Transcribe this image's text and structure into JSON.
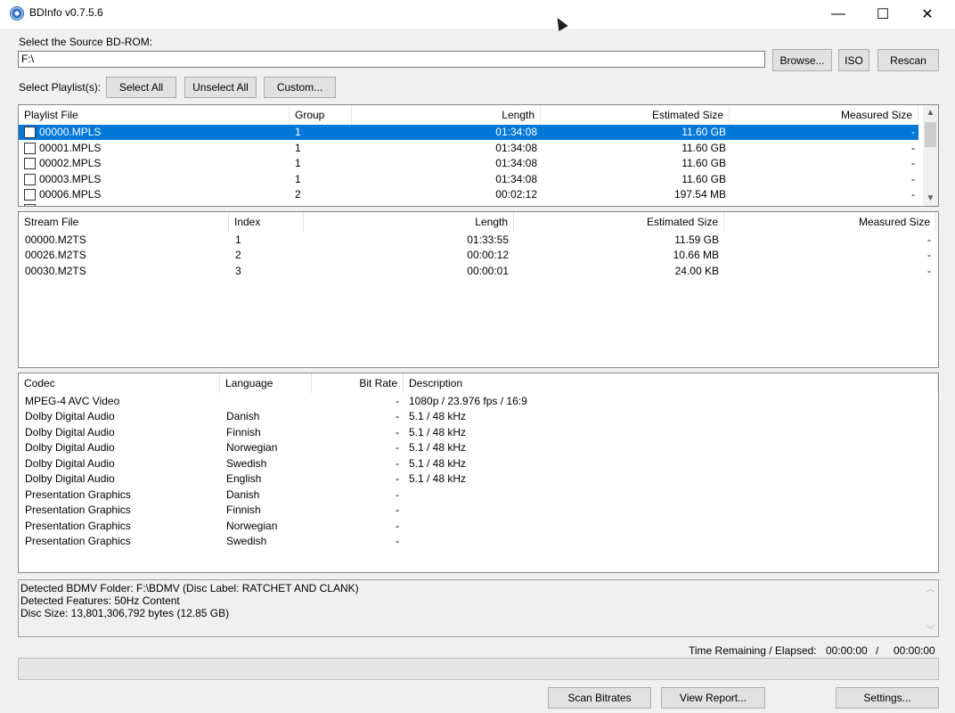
{
  "window": {
    "title": "BDInfo v0.7.5.6",
    "controls": [
      "—",
      "☐",
      "✕"
    ]
  },
  "source": {
    "label": "Select the Source BD-ROM:",
    "path": "F:\\",
    "browse": "Browse...",
    "iso": "ISO",
    "rescan": "Rescan"
  },
  "playlist_select": {
    "label": "Select Playlist(s):",
    "select_all": "Select All",
    "unselect_all": "Unselect All",
    "custom": "Custom..."
  },
  "playlists": {
    "headers": [
      "Playlist File",
      "Group",
      "Length",
      "Estimated Size",
      "Measured Size"
    ],
    "rows": [
      {
        "file": "00000.MPLS",
        "group": "1",
        "length": "01:34:08",
        "est": "11.60 GB",
        "meas": "-",
        "selected": true
      },
      {
        "file": "00001.MPLS",
        "group": "1",
        "length": "01:34:08",
        "est": "11.60 GB",
        "meas": "-"
      },
      {
        "file": "00002.MPLS",
        "group": "1",
        "length": "01:34:08",
        "est": "11.60 GB",
        "meas": "-"
      },
      {
        "file": "00003.MPLS",
        "group": "1",
        "length": "01:34:08",
        "est": "11.60 GB",
        "meas": "-"
      },
      {
        "file": "00006.MPLS",
        "group": "2",
        "length": "00:02:12",
        "est": "197.54 MB",
        "meas": "-"
      }
    ]
  },
  "streams": {
    "headers": [
      "Stream File",
      "Index",
      "Length",
      "Estimated Size",
      "Measured Size"
    ],
    "rows": [
      {
        "file": "00000.M2TS",
        "index": "1",
        "length": "01:33:55",
        "est": "11.59 GB",
        "meas": "-"
      },
      {
        "file": "00026.M2TS",
        "index": "2",
        "length": "00:00:12",
        "est": "10.66 MB",
        "meas": "-"
      },
      {
        "file": "00030.M2TS",
        "index": "3",
        "length": "00:00:01",
        "est": "24.00 KB",
        "meas": "-"
      }
    ]
  },
  "codecs": {
    "headers": [
      "Codec",
      "Language",
      "Bit Rate",
      "Description"
    ],
    "rows": [
      {
        "codec": "MPEG-4 AVC Video",
        "lang": "",
        "rate": "-",
        "desc": "1080p / 23.976 fps / 16:9"
      },
      {
        "codec": "Dolby Digital Audio",
        "lang": "Danish",
        "rate": "-",
        "desc": "5.1 / 48 kHz"
      },
      {
        "codec": "Dolby Digital Audio",
        "lang": "Finnish",
        "rate": "-",
        "desc": "5.1 / 48 kHz"
      },
      {
        "codec": "Dolby Digital Audio",
        "lang": "Norwegian",
        "rate": "-",
        "desc": "5.1 / 48 kHz"
      },
      {
        "codec": "Dolby Digital Audio",
        "lang": "Swedish",
        "rate": "-",
        "desc": "5.1 / 48 kHz"
      },
      {
        "codec": "Dolby Digital Audio",
        "lang": "English",
        "rate": "-",
        "desc": "5.1 / 48 kHz"
      },
      {
        "codec": "Presentation Graphics",
        "lang": "Danish",
        "rate": "-",
        "desc": ""
      },
      {
        "codec": "Presentation Graphics",
        "lang": "Finnish",
        "rate": "-",
        "desc": ""
      },
      {
        "codec": "Presentation Graphics",
        "lang": "Norwegian",
        "rate": "-",
        "desc": ""
      },
      {
        "codec": "Presentation Graphics",
        "lang": "Swedish",
        "rate": "-",
        "desc": ""
      }
    ]
  },
  "log": {
    "lines": [
      "Detected BDMV Folder: F:\\BDMV (Disc Label: RATCHET AND CLANK)",
      "Detected Features: 50Hz Content",
      "Disc Size: 13,801,306,792 bytes (12.85 GB)"
    ]
  },
  "status": {
    "time_label": "Time Remaining / Elapsed:",
    "remaining": "00:00:00",
    "separator": "/",
    "elapsed": "00:00:00",
    "progress": 0
  },
  "actions": {
    "scan": "Scan Bitrates",
    "report": "View Report...",
    "settings": "Settings..."
  },
  "colors": {
    "selection": "#0078d7",
    "window_bg": "#f0f0f0"
  }
}
